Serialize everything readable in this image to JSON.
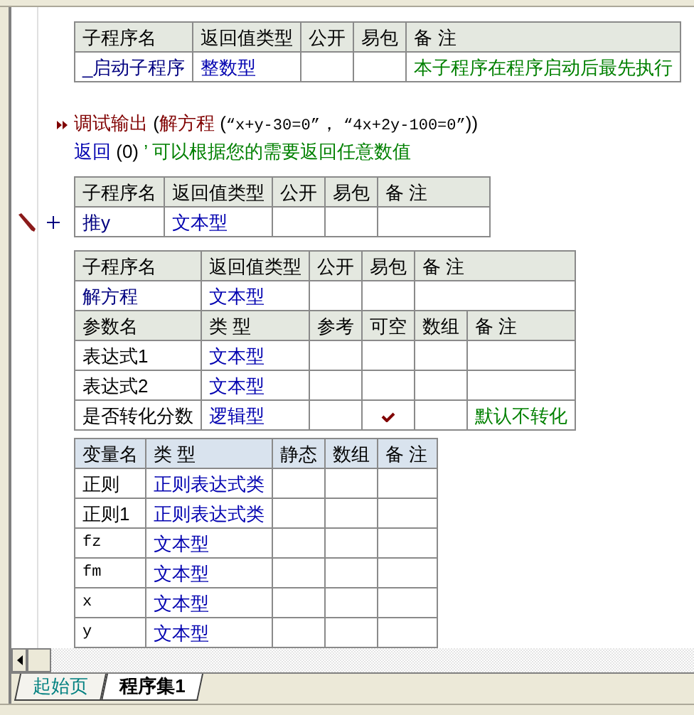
{
  "startup_sub": {
    "columns": [
      "子程序名",
      "返回值类型",
      "公开",
      "易包",
      "备 注"
    ],
    "rows": [
      {
        "name": "_启动子程序",
        "type": "整数型",
        "note": "本子程序在程序启动后最先执行"
      }
    ]
  },
  "code_lines": [
    {
      "breakpoint": true,
      "segments": [
        {
          "kind": "command",
          "text": "调试输出"
        },
        {
          "kind": "plain",
          "text": " ("
        },
        {
          "kind": "command",
          "text": "解方程"
        },
        {
          "kind": "plain",
          "text": " ("
        },
        {
          "kind": "string",
          "text": "“x+y-30=0”"
        },
        {
          "kind": "plain",
          "text": "， "
        },
        {
          "kind": "string",
          "text": "“4x+2y-100=0”"
        },
        {
          "kind": "plain",
          "text": "))"
        }
      ]
    },
    {
      "breakpoint": false,
      "segments": [
        {
          "kind": "keyword",
          "text": "返回"
        },
        {
          "kind": "plain",
          "text": " (0) "
        },
        {
          "kind": "comment",
          "text": "’ 可以根据您的需要返回任意数值"
        }
      ]
    }
  ],
  "sub_tuiy": {
    "columns": [
      "子程序名",
      "返回值类型",
      "公开",
      "易包",
      "备 注"
    ],
    "rows": [
      {
        "name": "推y",
        "type": "文本型"
      }
    ]
  },
  "sub_jiefangcheng": {
    "columns": [
      "子程序名",
      "返回值类型",
      "公开",
      "易包",
      "备 注"
    ],
    "rows": [
      {
        "name": "解方程",
        "type": "文本型"
      }
    ],
    "param_columns": [
      "参数名",
      "类 型",
      "参考",
      "可空",
      "数组",
      "备 注"
    ],
    "params": [
      {
        "name": "表达式1",
        "type": "文本型",
        "nullable": false
      },
      {
        "name": "表达式2",
        "type": "文本型",
        "nullable": false
      },
      {
        "name": "是否转化分数",
        "type": "逻辑型",
        "nullable": true,
        "note": "默认不转化"
      }
    ]
  },
  "variables": {
    "columns": [
      "变量名",
      "类 型",
      "静态",
      "数组",
      "备 注"
    ],
    "rows": [
      {
        "name": "正则",
        "type": "正则表达式类"
      },
      {
        "name": "正则1",
        "type": "正则表达式类"
      },
      {
        "name": "fz",
        "type": "文本型"
      },
      {
        "name": "fm",
        "type": "文本型"
      },
      {
        "name": "x",
        "type": "文本型"
      },
      {
        "name": "y",
        "type": "文本型"
      }
    ]
  },
  "tabs": [
    {
      "label": "起始页",
      "selected": false
    },
    {
      "label": "程序集1",
      "selected": true
    }
  ]
}
